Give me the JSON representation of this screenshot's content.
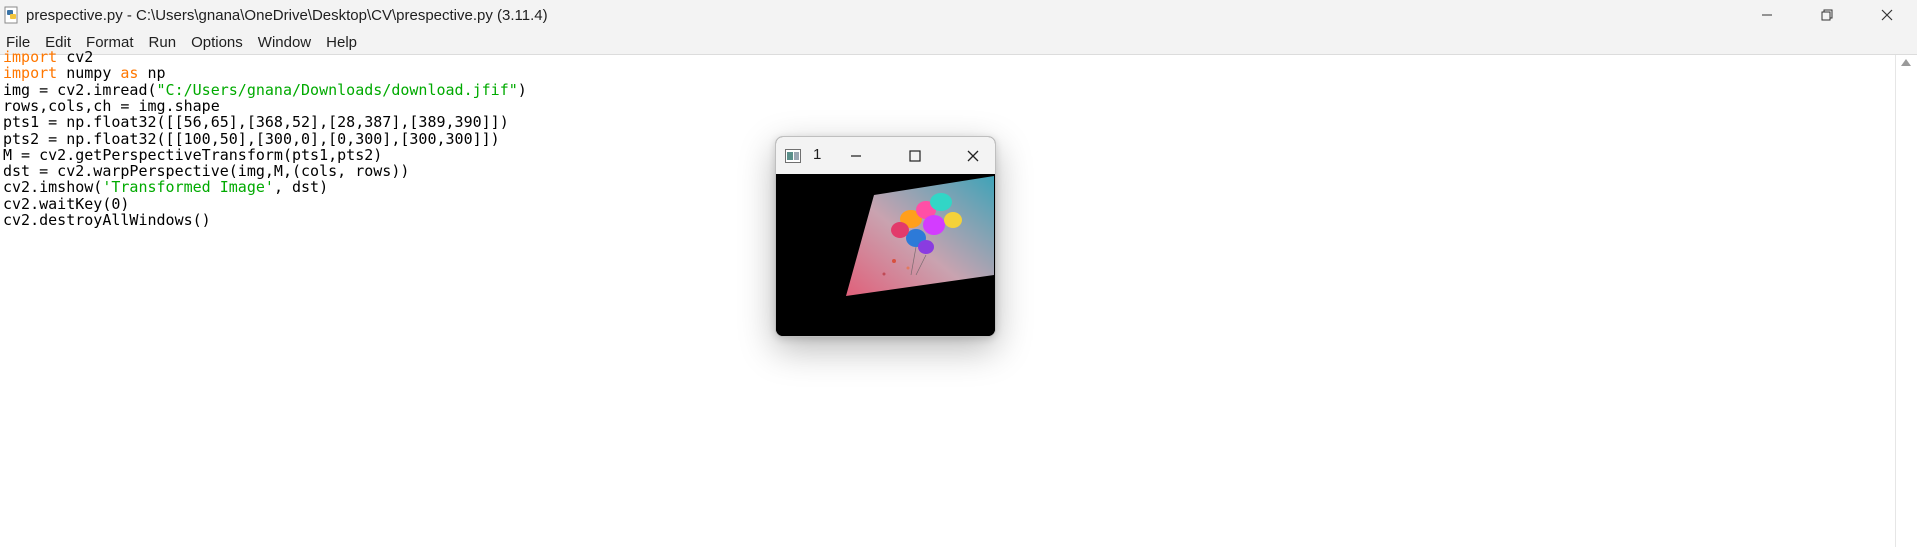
{
  "window": {
    "title": "prespective.py - C:\\Users\\gnana\\OneDrive\\Desktop\\CV\\prespective.py (3.11.4)"
  },
  "menu": {
    "items": [
      "File",
      "Edit",
      "Format",
      "Run",
      "Options",
      "Window",
      "Help"
    ]
  },
  "code": {
    "lines": [
      [
        {
          "t": "import",
          "c": "kw"
        },
        {
          "t": " cv2"
        }
      ],
      [
        {
          "t": "import",
          "c": "kw"
        },
        {
          "t": " numpy "
        },
        {
          "t": "as",
          "c": "kw"
        },
        {
          "t": " np"
        }
      ],
      [
        {
          "t": "img = cv2.imread("
        },
        {
          "t": "\"C:/Users/gnana/Downloads/download.jfif\"",
          "c": "str"
        },
        {
          "t": ")"
        }
      ],
      [
        {
          "t": "rows,cols,ch = img.shape"
        }
      ],
      [
        {
          "t": "pts1 = np.float32([[56,65],[368,52],[28,387],[389,390]])"
        }
      ],
      [
        {
          "t": "pts2 = np.float32([[100,50],[300,0],[0,300],[300,300]])"
        }
      ],
      [
        {
          "t": "M = cv2.getPerspectiveTransform(pts1,pts2)"
        }
      ],
      [
        {
          "t": "dst = cv2.warpPerspective(img,M,(cols, rows))"
        }
      ],
      [
        {
          "t": "cv2.imshow("
        },
        {
          "t": "'Transformed Image'",
          "c": "str"
        },
        {
          "t": ", dst)"
        }
      ],
      [
        {
          "t": "cv2.waitKey(0)"
        }
      ],
      [
        {
          "t": "cv2.destroyAllWindows()"
        }
      ]
    ]
  },
  "image_window": {
    "title": "1"
  },
  "icons": {
    "app": "python-file-icon",
    "minimize": "minimize-icon",
    "maximize": "maximize-icon",
    "close": "close-icon"
  },
  "colors": {
    "keyword": "#ff7700",
    "string": "#00aa00"
  }
}
